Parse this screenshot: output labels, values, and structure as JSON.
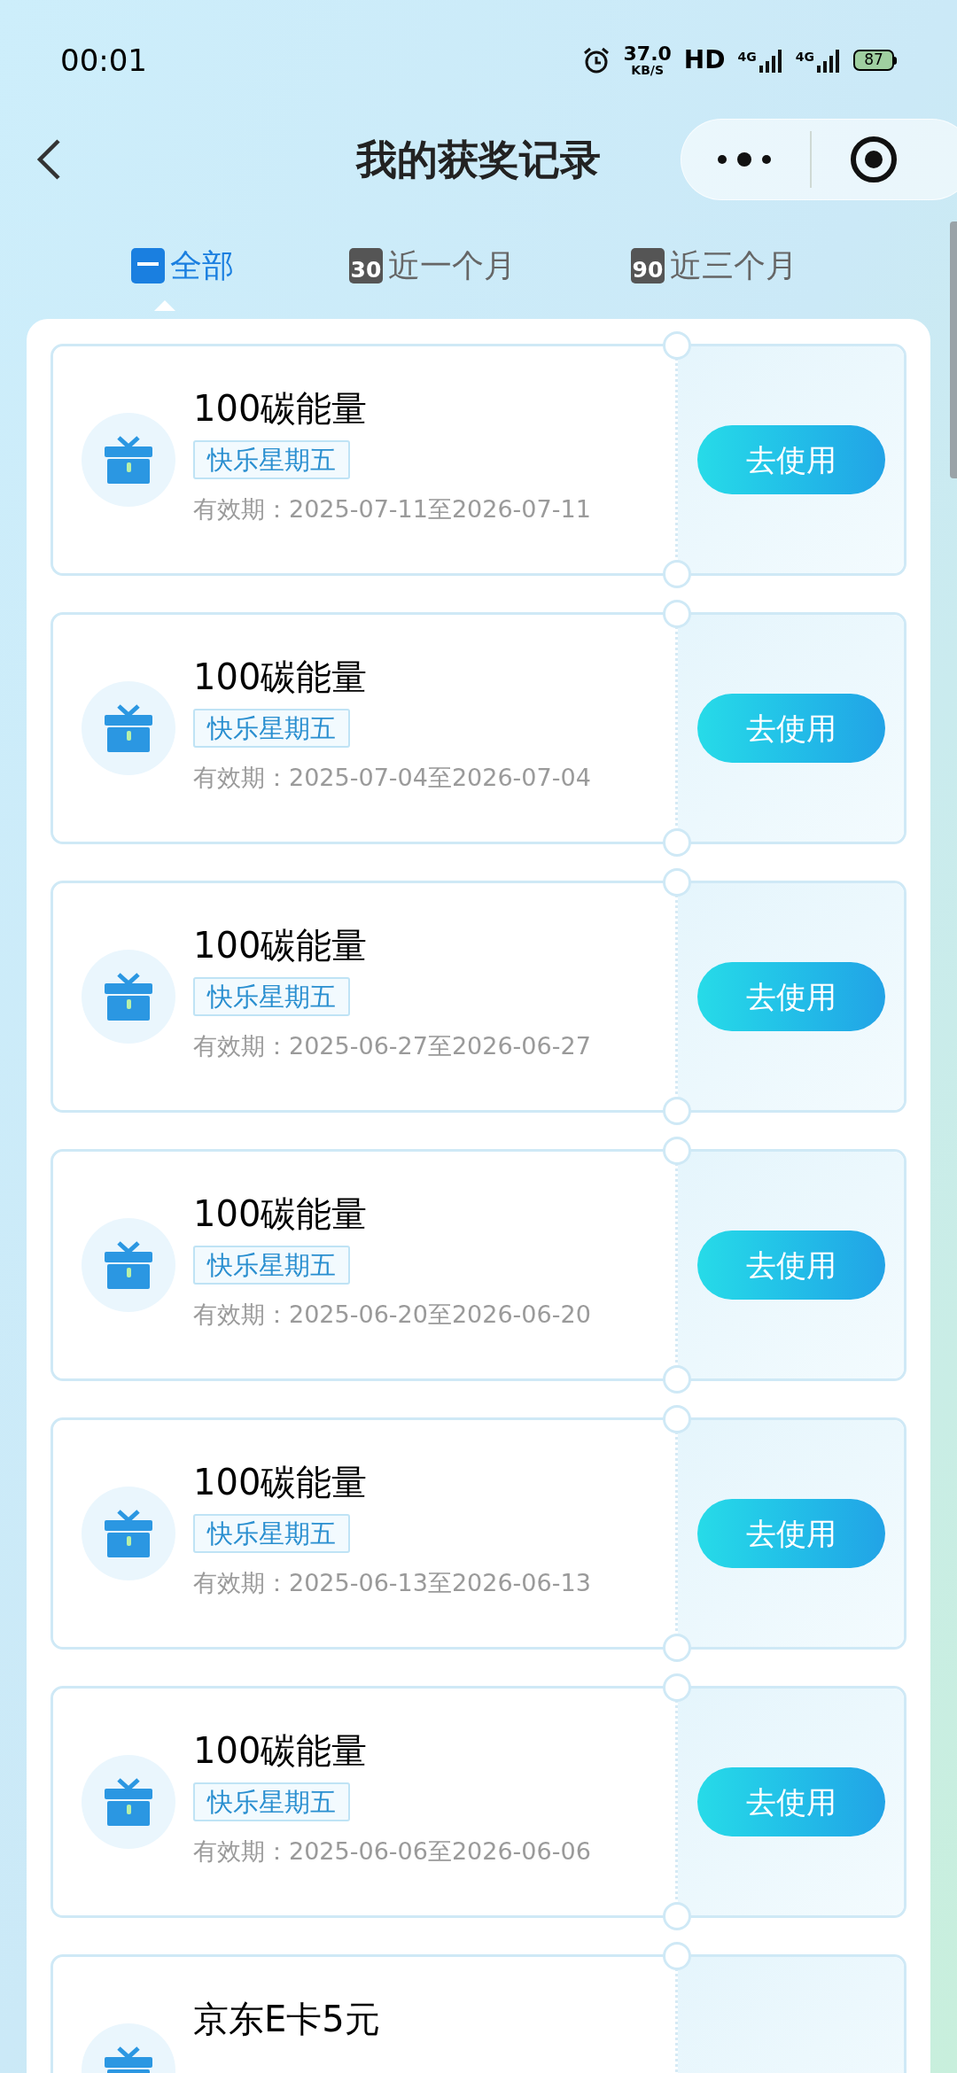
{
  "status_bar": {
    "time": "00:01",
    "net_speed": "37.0",
    "net_unit": "KB/S",
    "hd": "HD",
    "network_1": "4G",
    "network_2": "4G",
    "battery": "87"
  },
  "header": {
    "title": "我的获奖记录"
  },
  "tabs": [
    {
      "label": "全部",
      "selected": true
    },
    {
      "label": "近一个月",
      "icon_text": "30",
      "selected": false
    },
    {
      "label": "近三个月",
      "icon_text": "90",
      "selected": false
    }
  ],
  "records": [
    {
      "title": "100碳能量",
      "tag": "快乐星期五",
      "validity": "有效期：2025-07-11至2026-07-11",
      "button": "去使用"
    },
    {
      "title": "100碳能量",
      "tag": "快乐星期五",
      "validity": "有效期：2025-07-04至2026-07-04",
      "button": "去使用"
    },
    {
      "title": "100碳能量",
      "tag": "快乐星期五",
      "validity": "有效期：2025-06-27至2026-06-27",
      "button": "去使用"
    },
    {
      "title": "100碳能量",
      "tag": "快乐星期五",
      "validity": "有效期：2025-06-20至2026-06-20",
      "button": "去使用"
    },
    {
      "title": "100碳能量",
      "tag": "快乐星期五",
      "validity": "有效期：2025-06-13至2026-06-13",
      "button": "去使用"
    },
    {
      "title": "100碳能量",
      "tag": "快乐星期五",
      "validity": "有效期：2025-06-06至2026-06-06",
      "button": "去使用"
    },
    {
      "title": "京东E卡5元"
    }
  ]
}
